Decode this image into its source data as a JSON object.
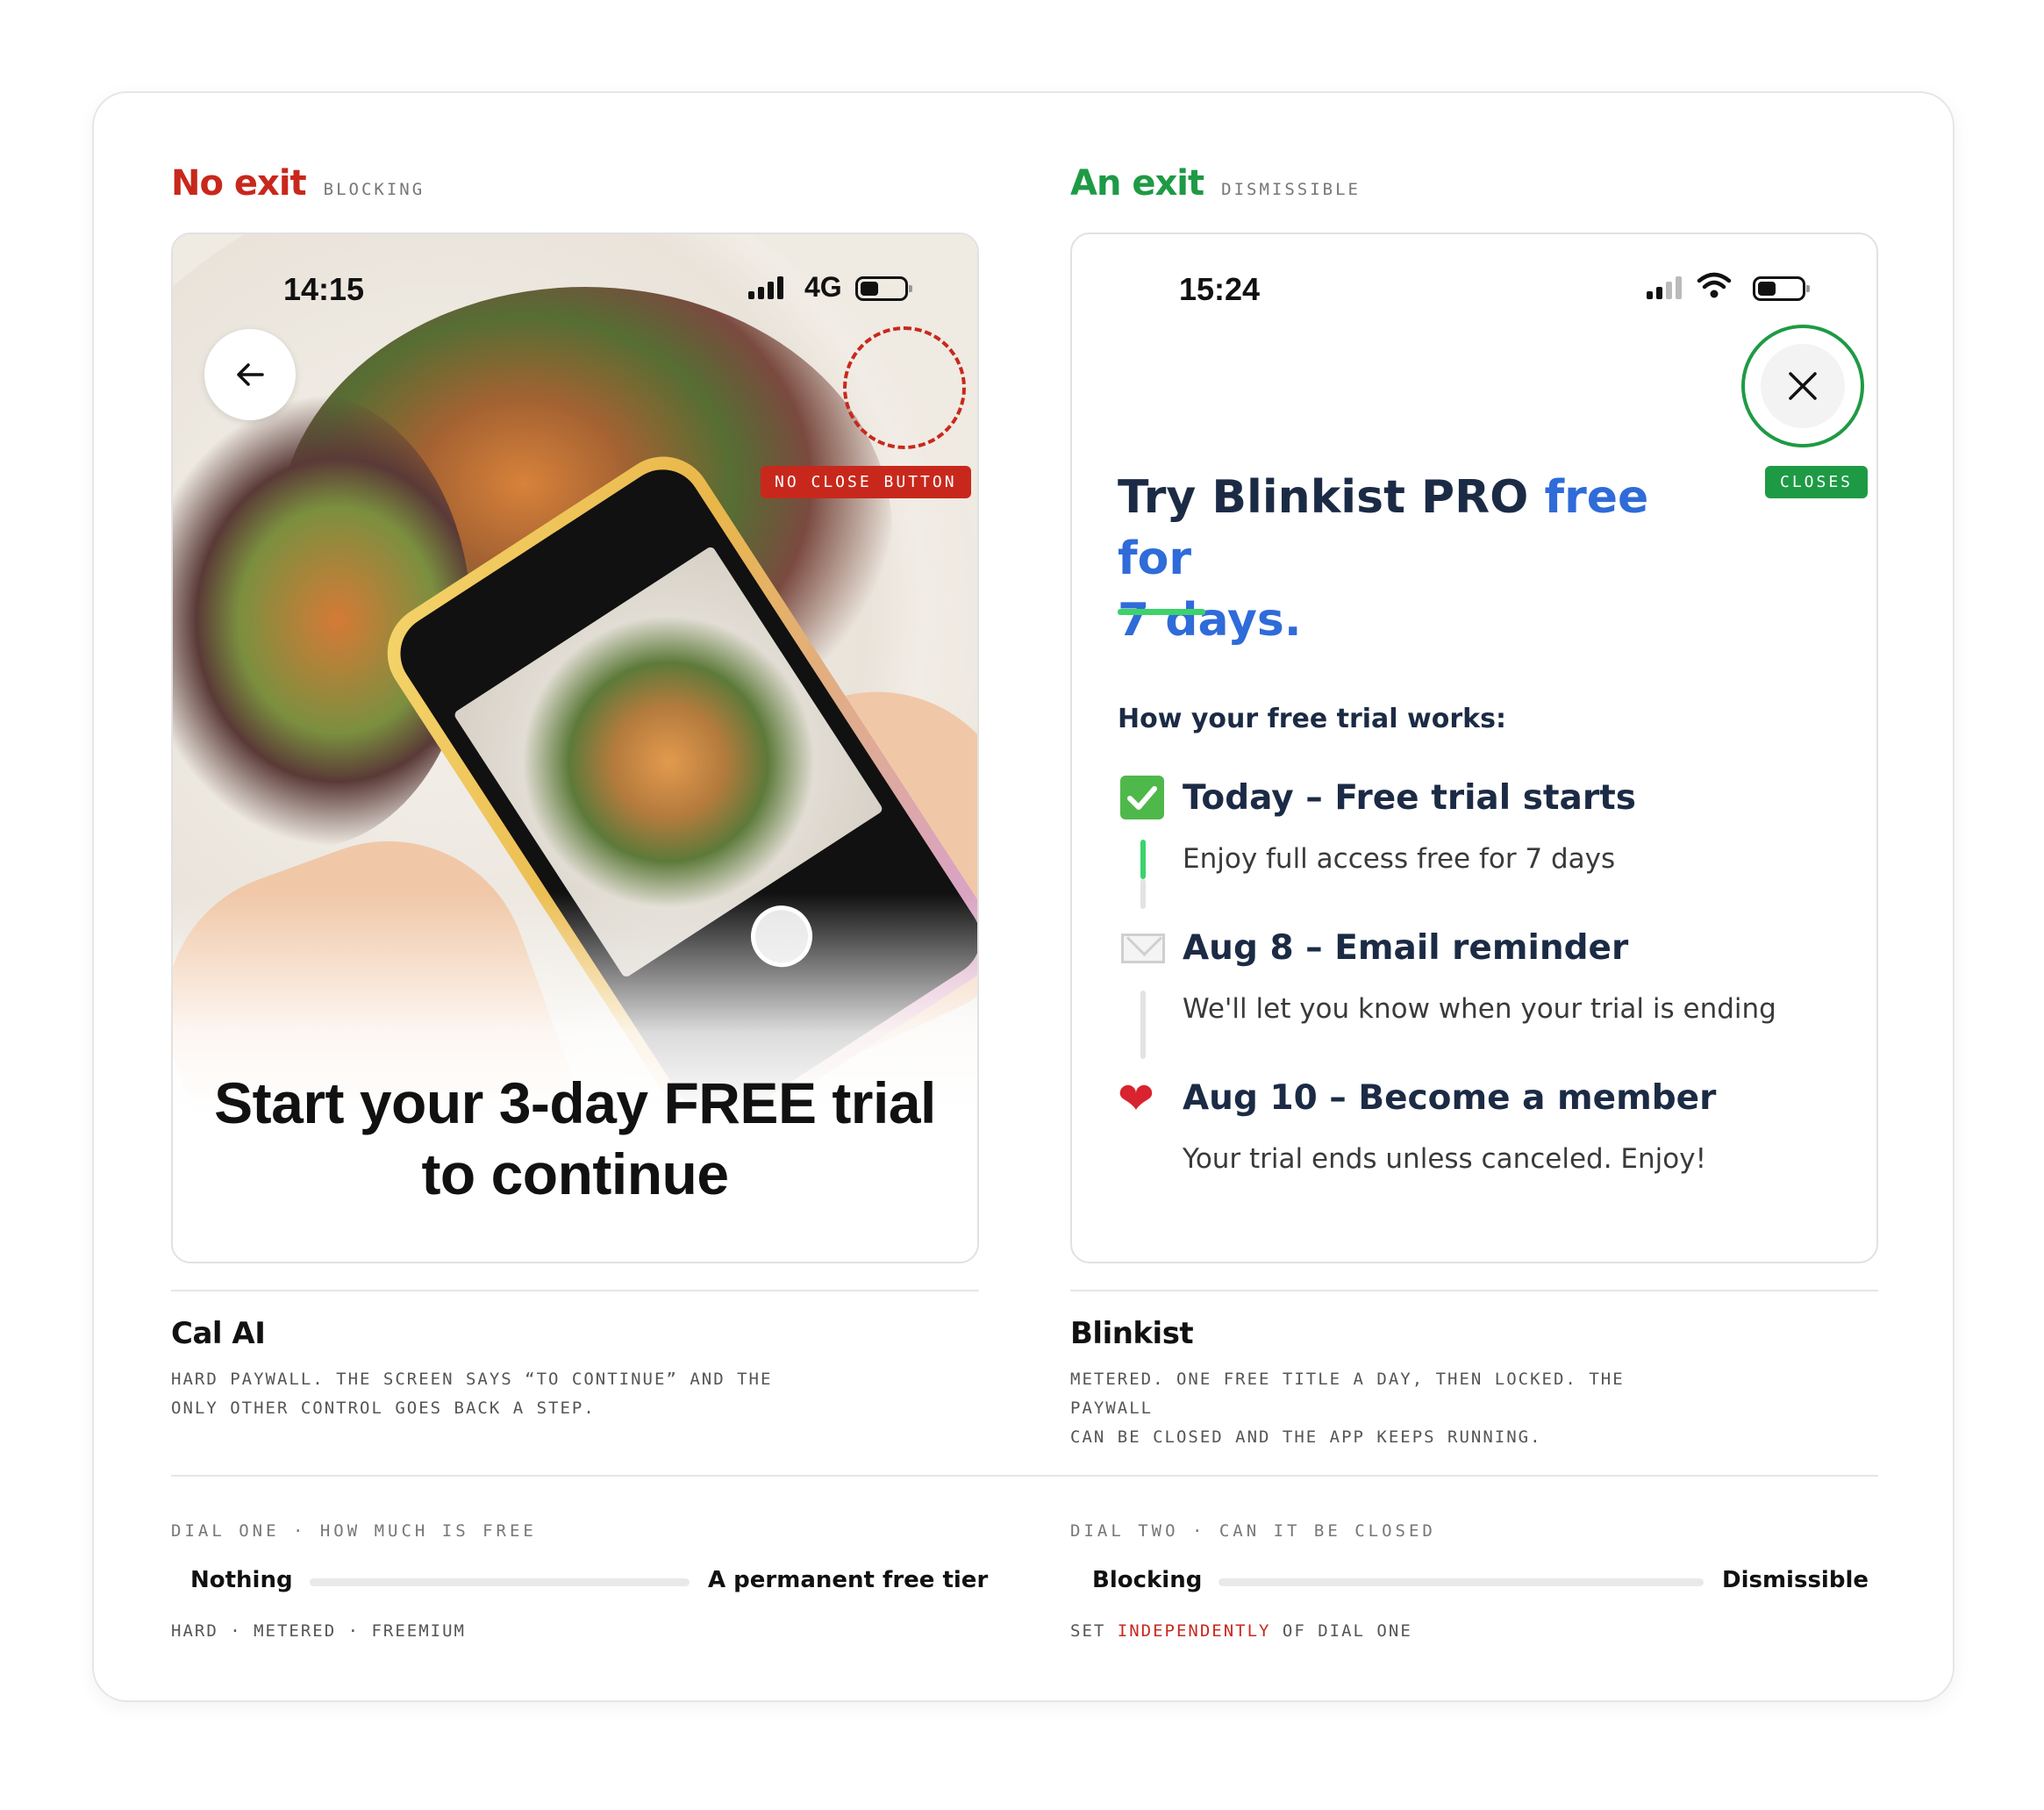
{
  "left": {
    "heading": "No exit",
    "heading_tag": "BLOCKING",
    "phone": {
      "time": "14:15",
      "network": "4G",
      "no_close_tag": "NO CLOSE BUTTON",
      "headline_line1": "Start your 3-day FREE trial",
      "headline_line2": "to continue"
    },
    "app_name": "Cal AI",
    "description_line1": "HARD PAYWALL. THE SCREEN SAYS “TO CONTINUE” AND THE",
    "description_line2": "ONLY OTHER CONTROL GOES BACK A STEP.",
    "dial": {
      "label": "DIAL ONE · HOW MUCH IS FREE",
      "min_label": "Nothing",
      "max_label": "A permanent free tier",
      "note": "HARD · METERED · FREEMIUM"
    }
  },
  "right": {
    "heading": "An exit",
    "heading_tag": "DISMISSIBLE",
    "phone": {
      "time": "15:24",
      "closes_tag": "CLOSES",
      "title_part1": "Try Blinkist PRO ",
      "title_part2": "free for",
      "title_part3": "7 days.",
      "subtitle": "How your free trial works:",
      "steps": [
        {
          "icon": "check-icon",
          "head": "Today – Free trial starts",
          "body": "Enjoy full access free for 7 days"
        },
        {
          "icon": "envelope-icon",
          "head": "Aug 8 – Email reminder",
          "body": "We'll let you know when your trial is ending"
        },
        {
          "icon": "heart-icon",
          "head": "Aug 10 – Become a member",
          "body": "Your trial ends unless canceled. Enjoy!"
        }
      ]
    },
    "app_name": "Blinkist",
    "description_line1": "METERED. ONE FREE TITLE A DAY, THEN LOCKED. THE PAYWALL",
    "description_line2": "CAN BE CLOSED AND THE APP KEEPS RUNNING.",
    "dial": {
      "label": "DIAL TWO · CAN IT BE CLOSED",
      "min_label": "Blocking",
      "max_label": "Dismissible",
      "note_prefix": "SET ",
      "note_highlight": "INDEPENDENTLY",
      "note_suffix": " OF DIAL ONE"
    }
  },
  "colors": {
    "red": "#c8281c",
    "green": "#1e9a45",
    "blue": "#2f6bd9",
    "navy": "#1c2b45"
  }
}
